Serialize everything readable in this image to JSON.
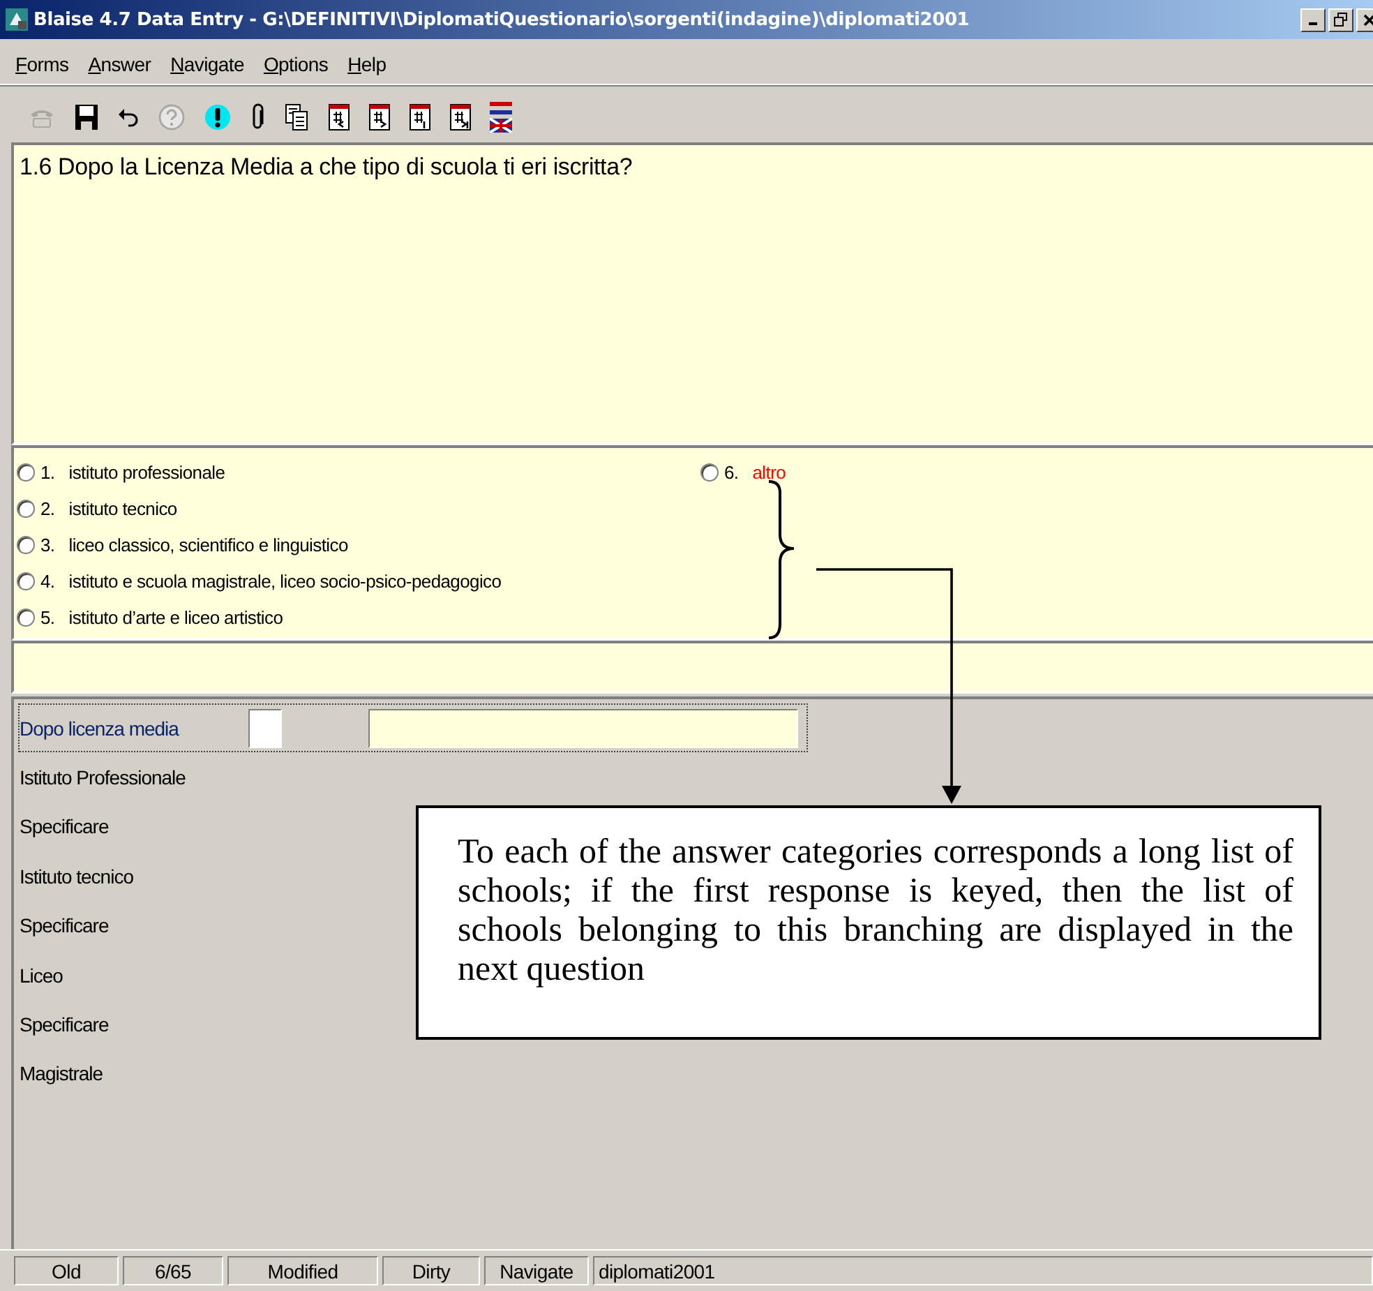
{
  "window": {
    "title": "Blaise 4.7 Data Entry - G:\\DEFINITIVI\\DiplomatiQuestionario\\sorgenti(indagine)\\diplomati2001",
    "controls": [
      {
        "kind": "minimize"
      },
      {
        "kind": "restore"
      },
      {
        "kind": "close"
      }
    ]
  },
  "menu": [
    {
      "label": "Forms"
    },
    {
      "label": "Answer"
    },
    {
      "label": "Navigate"
    },
    {
      "label": "Options"
    },
    {
      "label": "Help"
    }
  ],
  "toolbar": [
    {
      "kind": "phone",
      "disabled": true
    },
    {
      "kind": "save",
      "disabled": false
    },
    {
      "kind": "undo",
      "disabled": false
    },
    {
      "kind": "help",
      "disabled": true
    },
    {
      "kind": "remark",
      "disabled": false
    },
    {
      "kind": "clip",
      "disabled": false
    },
    {
      "kind": "copy",
      "disabled": false
    },
    {
      "kind": "page-first",
      "disabled": false
    },
    {
      "kind": "page-next",
      "disabled": false
    },
    {
      "kind": "page-one",
      "disabled": false
    },
    {
      "kind": "page-last",
      "disabled": false
    },
    {
      "kind": "flag",
      "disabled": false
    }
  ],
  "question": {
    "text": "1.6 Dopo la Licenza Media a che tipo di scuola ti eri iscritta?"
  },
  "answers": [
    {
      "number": "1.",
      "label": "istituto professionale",
      "selected": false,
      "color": "#000000"
    },
    {
      "number": "2.",
      "label": "istituto tecnico",
      "selected": false,
      "color": "#000000"
    },
    {
      "number": "3.",
      "label": "liceo classico, scientifico e linguistico",
      "selected": false,
      "color": "#000000"
    },
    {
      "number": "4.",
      "label": "istituto e scuola magistrale, liceo socio-psico-pedagogico",
      "selected": false,
      "color": "#000000"
    },
    {
      "number": "5.",
      "label": "istituto d’arte e liceo artistico",
      "selected": false,
      "color": "#000000"
    },
    {
      "number": "6.",
      "label": "altro",
      "selected": false,
      "color": "#ff0000"
    }
  ],
  "form_fields": [
    {
      "label": "Dopo licenza media",
      "focused": true
    },
    {
      "label": "Istituto Professionale",
      "focused": false
    },
    {
      "label": "Specificare",
      "focused": false
    },
    {
      "label": "Istituto tecnico",
      "focused": false
    },
    {
      "label": "Specificare",
      "focused": false
    },
    {
      "label": "Liceo",
      "focused": false
    },
    {
      "label": "Specificare",
      "focused": false
    },
    {
      "label": "Magistrale",
      "focused": false
    }
  ],
  "status_bar": [
    "Old",
    "6/65",
    "Modified",
    "Dirty",
    "Navigate",
    "diplomati2001"
  ],
  "callout": {
    "text": "To each of the answer categories corresponds a long list of schools; if the first response is keyed, then the list of schools belonging to this branching are displayed in the next question"
  }
}
